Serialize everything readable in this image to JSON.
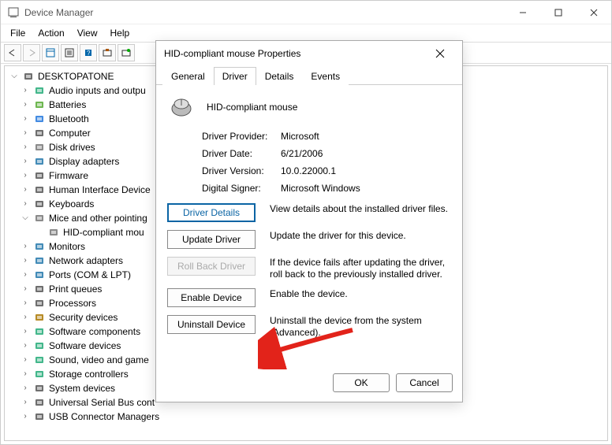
{
  "window": {
    "title": "Device Manager",
    "menus": [
      "File",
      "Action",
      "View",
      "Help"
    ]
  },
  "tree": {
    "root": "DESKTOPATONE",
    "items": [
      {
        "label": "Audio inputs and outpu",
        "icon": "audio",
        "expandable": true
      },
      {
        "label": "Batteries",
        "icon": "battery",
        "expandable": true
      },
      {
        "label": "Bluetooth",
        "icon": "bluetooth",
        "expandable": true
      },
      {
        "label": "Computer",
        "icon": "computer",
        "expandable": true
      },
      {
        "label": "Disk drives",
        "icon": "disk",
        "expandable": true
      },
      {
        "label": "Display adapters",
        "icon": "display",
        "expandable": true
      },
      {
        "label": "Firmware",
        "icon": "chip",
        "expandable": true
      },
      {
        "label": "Human Interface Device",
        "icon": "hid",
        "expandable": true
      },
      {
        "label": "Keyboards",
        "icon": "keyboard",
        "expandable": true
      },
      {
        "label": "Mice and other pointing",
        "icon": "mouse",
        "expandable": true,
        "expanded": true,
        "children": [
          {
            "label": "HID-compliant mou",
            "icon": "mouse"
          }
        ]
      },
      {
        "label": "Monitors",
        "icon": "monitor",
        "expandable": true
      },
      {
        "label": "Network adapters",
        "icon": "network",
        "expandable": true
      },
      {
        "label": "Ports (COM & LPT)",
        "icon": "port",
        "expandable": true
      },
      {
        "label": "Print queues",
        "icon": "printer",
        "expandable": true
      },
      {
        "label": "Processors",
        "icon": "cpu",
        "expandable": true
      },
      {
        "label": "Security devices",
        "icon": "security",
        "expandable": true
      },
      {
        "label": "Software components",
        "icon": "swcomp",
        "expandable": true
      },
      {
        "label": "Software devices",
        "icon": "swdev",
        "expandable": true
      },
      {
        "label": "Sound, video and game",
        "icon": "sound",
        "expandable": true
      },
      {
        "label": "Storage controllers",
        "icon": "storage",
        "expandable": true
      },
      {
        "label": "System devices",
        "icon": "system",
        "expandable": true
      },
      {
        "label": "Universal Serial Bus cont",
        "icon": "usb",
        "expandable": true
      },
      {
        "label": "USB Connector Managers",
        "icon": "usbconn",
        "expandable": true
      }
    ]
  },
  "dialog": {
    "title": "HID-compliant mouse Properties",
    "tabs": [
      "General",
      "Driver",
      "Details",
      "Events"
    ],
    "active_tab": 1,
    "device_name": "HID-compliant mouse",
    "info": [
      {
        "label": "Driver Provider:",
        "value": "Microsoft"
      },
      {
        "label": "Driver Date:",
        "value": "6/21/2006"
      },
      {
        "label": "Driver Version:",
        "value": "10.0.22000.1"
      },
      {
        "label": "Digital Signer:",
        "value": "Microsoft Windows"
      }
    ],
    "actions": [
      {
        "label": "Driver Details",
        "desc": "View details about the installed driver files.",
        "primary": true,
        "disabled": false
      },
      {
        "label": "Update Driver",
        "desc": "Update the driver for this device.",
        "primary": false,
        "disabled": false
      },
      {
        "label": "Roll Back Driver",
        "desc": "If the device fails after updating the driver, roll back to the previously installed driver.",
        "primary": false,
        "disabled": true
      },
      {
        "label": "Enable Device",
        "desc": "Enable the device.",
        "primary": false,
        "disabled": false
      },
      {
        "label": "Uninstall Device",
        "desc": "Uninstall the device from the system (Advanced).",
        "primary": false,
        "disabled": false
      }
    ],
    "footer": {
      "ok": "OK",
      "cancel": "Cancel"
    }
  }
}
